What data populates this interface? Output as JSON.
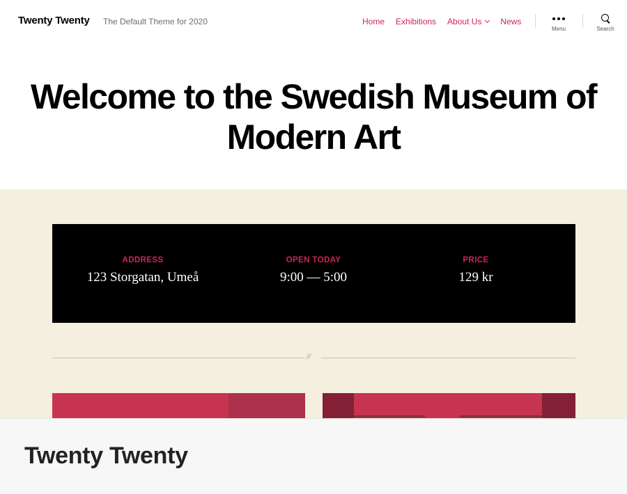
{
  "header": {
    "site_title": "Twenty Twenty",
    "site_description": "The Default Theme for 2020",
    "nav": [
      {
        "label": "Home"
      },
      {
        "label": "Exhibitions"
      },
      {
        "label": "About Us",
        "has_dropdown": true
      },
      {
        "label": "News"
      }
    ],
    "menu_label": "Menu",
    "search_label": "Search",
    "menu_icon": "ellipsis-icon",
    "search_icon": "search-icon"
  },
  "hero": {
    "title": "Welcome to the Swedish Museum of Modern Art"
  },
  "info": [
    {
      "label": "ADDRESS",
      "value": "123 Storgatan, Umeå"
    },
    {
      "label": "OPEN TODAY",
      "value": "9:00 — 5:00"
    },
    {
      "label": "PRICE",
      "value": "129 kr"
    }
  ],
  "separator_mark": "//",
  "bottom_bar": {
    "title": "Twenty Twenty"
  },
  "colors": {
    "accent": "#cd2653",
    "beige_background": "#f5efe0",
    "info_box": "#000000"
  }
}
